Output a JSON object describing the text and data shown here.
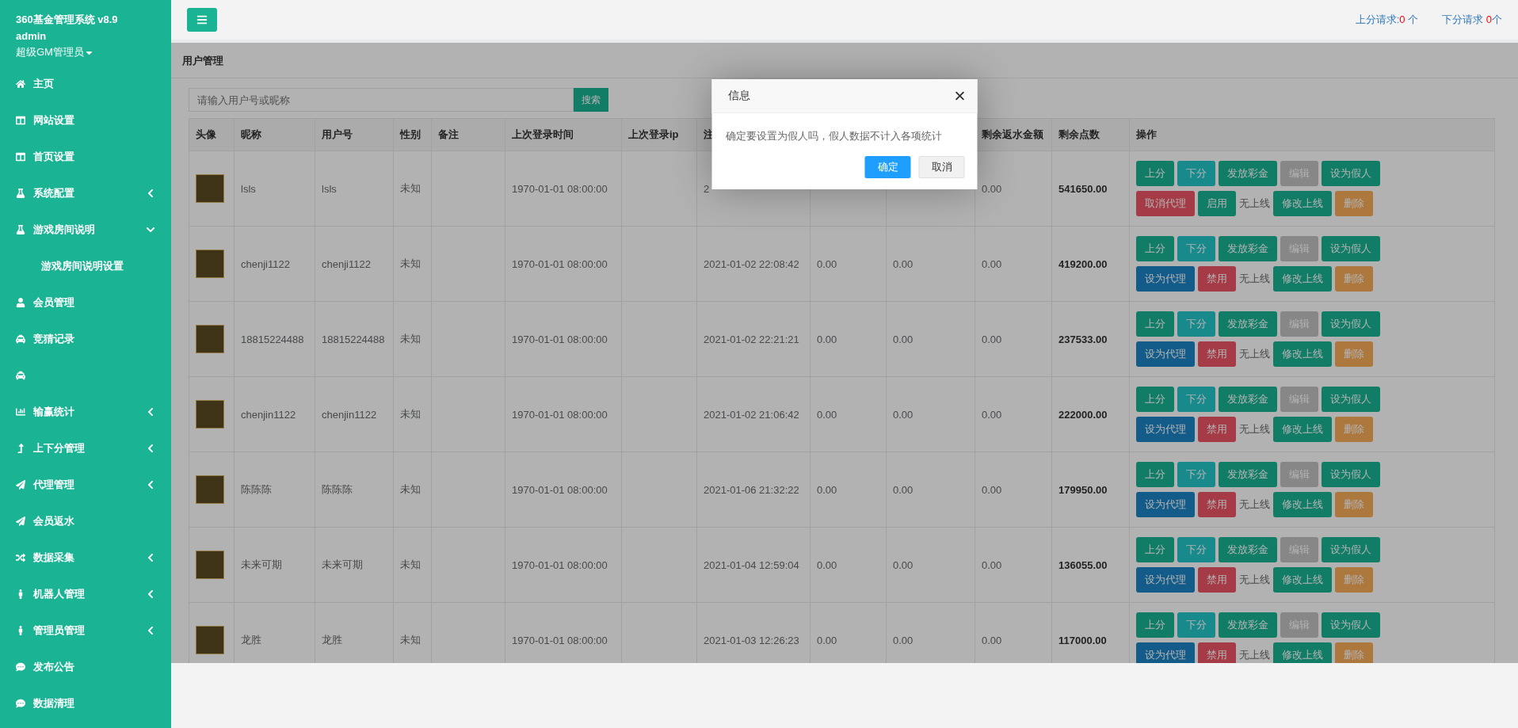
{
  "sidebar": {
    "title": "360基金管理系统 v8.9",
    "user": "admin",
    "role": "超级GM管理员",
    "items": [
      {
        "label": "主页"
      },
      {
        "label": "网站设置"
      },
      {
        "label": "首页设置"
      },
      {
        "label": "系统配置",
        "expanded": false
      },
      {
        "label": "游戏房间说明",
        "expanded": true,
        "children": [
          {
            "label": "游戏房间说明设置"
          }
        ]
      },
      {
        "label": "会员管理"
      },
      {
        "label": "竞猜记录"
      },
      {
        "kind": "icon"
      },
      {
        "label": "输赢统计",
        "expanded": false
      },
      {
        "label": "上下分管理",
        "expanded": false
      },
      {
        "label": "代理管理",
        "expanded": false
      },
      {
        "label": "会员返水"
      },
      {
        "label": "数据采集",
        "expanded": false
      },
      {
        "label": "机器人管理",
        "expanded": false
      },
      {
        "label": "管理员管理",
        "expanded": false
      },
      {
        "label": "发布公告"
      },
      {
        "label": "数据清理"
      }
    ]
  },
  "topbar": {
    "requests": [
      {
        "label": "上分请求:",
        "count": "0",
        "unit": " 个"
      },
      {
        "label": "下分请求 ",
        "count": "0",
        "unit": "个"
      }
    ]
  },
  "breadcrumb": "用户管理",
  "search": {
    "placeholder": "请输入用户号或昵称",
    "button": "搜索"
  },
  "table": {
    "columns": [
      "头像",
      "昵称",
      "用户号",
      "性别",
      "备注",
      "上次登录时间",
      "上次登录ip",
      "注",
      null,
      null,
      "剩余返水金额",
      "剩余点数",
      "操作"
    ],
    "rows": [
      {
        "cells": [
          "",
          "lsls",
          "lsls",
          "未知",
          "",
          "1970-01-01 08:00:00",
          "",
          "2",
          null,
          null,
          "0.00",
          "541650.00"
        ],
        "actions": [
          {
            "label": "上分",
            "kind": "primary"
          },
          {
            "label": "下分",
            "kind": "info"
          },
          {
            "label": "发放彩金",
            "kind": "primary"
          },
          {
            "label": "编辑",
            "kind": "muted"
          },
          {
            "label": "设为假人",
            "kind": "primary"
          },
          {
            "label": "取消代理",
            "kind": "danger"
          },
          {
            "label": "启用",
            "kind": "primary"
          },
          {
            "label": "无上线",
            "kind": "text"
          },
          {
            "label": "修改上线",
            "kind": "primary"
          },
          {
            "label": "删除",
            "kind": "warning"
          }
        ]
      },
      {
        "cells": [
          "",
          "chenji1122",
          "chenji1122",
          "未知",
          "",
          "1970-01-01 08:00:00",
          "",
          "2021-01-02 22:08:42",
          "0.00",
          "0.00",
          "0.00",
          "419200.00"
        ],
        "actions": [
          {
            "label": "上分",
            "kind": "primary"
          },
          {
            "label": "下分",
            "kind": "info"
          },
          {
            "label": "发放彩金",
            "kind": "primary"
          },
          {
            "label": "编辑",
            "kind": "muted"
          },
          {
            "label": "设为假人",
            "kind": "primary"
          },
          {
            "label": "设为代理",
            "kind": "blue"
          },
          {
            "label": "禁用",
            "kind": "danger"
          },
          {
            "label": "无上线",
            "kind": "text"
          },
          {
            "label": "修改上线",
            "kind": "primary"
          },
          {
            "label": "删除",
            "kind": "warning"
          }
        ]
      },
      {
        "cells": [
          "",
          "18815224488",
          "18815224488",
          "未知",
          "",
          "1970-01-01 08:00:00",
          "",
          "2021-01-02 22:21:21",
          "0.00",
          "0.00",
          "0.00",
          "237533.00"
        ],
        "actions": [
          {
            "label": "上分",
            "kind": "primary"
          },
          {
            "label": "下分",
            "kind": "info"
          },
          {
            "label": "发放彩金",
            "kind": "primary"
          },
          {
            "label": "编辑",
            "kind": "muted"
          },
          {
            "label": "设为假人",
            "kind": "primary"
          },
          {
            "label": "设为代理",
            "kind": "blue"
          },
          {
            "label": "禁用",
            "kind": "danger"
          },
          {
            "label": "无上线",
            "kind": "text"
          },
          {
            "label": "修改上线",
            "kind": "primary"
          },
          {
            "label": "删除",
            "kind": "warning"
          }
        ]
      },
      {
        "cells": [
          "",
          "chenjin1122",
          "chenjin1122",
          "未知",
          "",
          "1970-01-01 08:00:00",
          "",
          "2021-01-02 21:06:42",
          "0.00",
          "0.00",
          "0.00",
          "222000.00"
        ],
        "actions": [
          {
            "label": "上分",
            "kind": "primary"
          },
          {
            "label": "下分",
            "kind": "info"
          },
          {
            "label": "发放彩金",
            "kind": "primary"
          },
          {
            "label": "编辑",
            "kind": "muted"
          },
          {
            "label": "设为假人",
            "kind": "primary"
          },
          {
            "label": "设为代理",
            "kind": "blue"
          },
          {
            "label": "禁用",
            "kind": "danger"
          },
          {
            "label": "无上线",
            "kind": "text"
          },
          {
            "label": "修改上线",
            "kind": "primary"
          },
          {
            "label": "删除",
            "kind": "warning"
          }
        ]
      },
      {
        "cells": [
          "",
          "陈陈陈",
          "陈陈陈",
          "未知",
          "",
          "1970-01-01 08:00:00",
          "",
          "2021-01-06 21:32:22",
          "0.00",
          "0.00",
          "0.00",
          "179950.00"
        ],
        "actions": [
          {
            "label": "上分",
            "kind": "primary"
          },
          {
            "label": "下分",
            "kind": "info"
          },
          {
            "label": "发放彩金",
            "kind": "primary"
          },
          {
            "label": "编辑",
            "kind": "muted"
          },
          {
            "label": "设为假人",
            "kind": "primary"
          },
          {
            "label": "设为代理",
            "kind": "blue"
          },
          {
            "label": "禁用",
            "kind": "danger"
          },
          {
            "label": "无上线",
            "kind": "text"
          },
          {
            "label": "修改上线",
            "kind": "primary"
          },
          {
            "label": "删除",
            "kind": "warning"
          }
        ]
      },
      {
        "cells": [
          "",
          "未来可期",
          "未来可期",
          "未知",
          "",
          "1970-01-01 08:00:00",
          "",
          "2021-01-04 12:59:04",
          "0.00",
          "0.00",
          "0.00",
          "136055.00"
        ],
        "actions": [
          {
            "label": "上分",
            "kind": "primary"
          },
          {
            "label": "下分",
            "kind": "info"
          },
          {
            "label": "发放彩金",
            "kind": "primary"
          },
          {
            "label": "编辑",
            "kind": "muted"
          },
          {
            "label": "设为假人",
            "kind": "primary"
          },
          {
            "label": "设为代理",
            "kind": "blue"
          },
          {
            "label": "禁用",
            "kind": "danger"
          },
          {
            "label": "无上线",
            "kind": "text"
          },
          {
            "label": "修改上线",
            "kind": "primary"
          },
          {
            "label": "删除",
            "kind": "warning"
          }
        ]
      },
      {
        "cells": [
          "",
          "龙胜",
          "龙胜",
          "未知",
          "",
          "1970-01-01 08:00:00",
          "",
          "2021-01-03 12:26:23",
          "0.00",
          "0.00",
          "0.00",
          "117000.00"
        ],
        "actions": [
          {
            "label": "上分",
            "kind": "primary"
          },
          {
            "label": "下分",
            "kind": "info"
          },
          {
            "label": "发放彩金",
            "kind": "primary"
          },
          {
            "label": "编辑",
            "kind": "muted"
          },
          {
            "label": "设为假人",
            "kind": "primary"
          },
          {
            "label": "设为代理",
            "kind": "blue"
          },
          {
            "label": "禁用",
            "kind": "danger"
          },
          {
            "label": "无上线",
            "kind": "text"
          },
          {
            "label": "修改上线",
            "kind": "primary"
          },
          {
            "label": "删除",
            "kind": "warning"
          }
        ]
      }
    ]
  },
  "dialog": {
    "title": "信息",
    "message": "确定要设置为假人吗，假人数据不计入各项统计",
    "buttons": [
      {
        "label": "确定",
        "kind": "primary"
      },
      {
        "label": "取消",
        "kind": "default"
      }
    ]
  }
}
